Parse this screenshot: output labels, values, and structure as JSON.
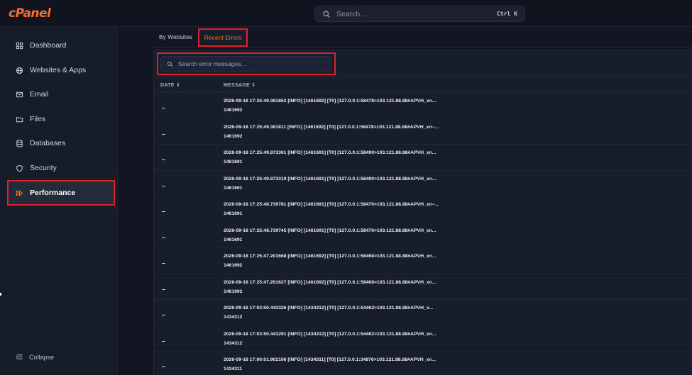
{
  "app": {
    "logo": "cPanel"
  },
  "search": {
    "placeholder": "Search...",
    "shortcut": "Ctrl K"
  },
  "sidebar": {
    "items": [
      {
        "label": "Dashboard",
        "icon": "grid-icon"
      },
      {
        "label": "Websites & Apps",
        "icon": "globe-icon"
      },
      {
        "label": "Email",
        "icon": "mail-icon"
      },
      {
        "label": "Files",
        "icon": "folder-icon"
      },
      {
        "label": "Databases",
        "icon": "database-icon"
      },
      {
        "label": "Security",
        "icon": "shield-icon"
      },
      {
        "label": "Performance",
        "icon": "fast-forward-icon",
        "active": true
      }
    ],
    "collapse_label": "Collapse"
  },
  "tabs": {
    "by_websites": "By Websites",
    "recent_errors": "Recent Errors"
  },
  "error_search": {
    "placeholder": "Search error messages..."
  },
  "table": {
    "columns": {
      "date": "DATE ⇕",
      "message": "MESSAGE ⇕"
    },
    "rows": [
      {
        "date": "–",
        "line1": "2026-09-18 17:25:49.361852 [INFO] [1461692] [T0] [127.0.0.1:58478>103.121.88.88#APVH_xn...",
        "line2": "1461692"
      },
      {
        "date": "–",
        "line1": "2026-09-18 17:25:49.361811 [INFO] [1461692] [T0] [127.0.0.1:58478>103.121.88.88#APVH_xn--...",
        "line2": "1461692"
      },
      {
        "date": "–",
        "line1": "2026-09-18 17:25:49.873361 [INFO] [1461691] [T0] [127.0.0.1:58490>103.121.88.88#APVH_xn...",
        "line2": "1461691"
      },
      {
        "date": "–",
        "line1": "2026-09-18 17:25:49.873319 [INFO] [1461691] [T0] [127.0.0.1:58490>103.121.88.88#APVH_xn...",
        "line2": "1461691"
      },
      {
        "date": "–",
        "line1": "2026-09-18 17:25:48.739781 [INFO] [1461691] [T0] [127.0.0.1:58470>103.121.88.88#APVH_xn--...",
        "line2": "1461691"
      },
      {
        "date": "–",
        "line1": "2026-09-18 17:25:48.739745 [INFO] [1461691] [T0] [127.0.0.1:58470>103.121.88.88#APVH_xn...",
        "line2": "1461691"
      },
      {
        "date": "–",
        "line1": "2026-09-18 17:25:47.201668 [INFO] [1461692] [T0] [127.0.0.1:58468>103.121.88.88#APVH_xn...",
        "line2": "1461692"
      },
      {
        "date": "–",
        "line1": "2026-09-18 17:25:47.201627 [INFO] [1461692] [T0] [127.0.0.1:58468>103.121.88.88#APVH_xn...",
        "line2": "1461692"
      },
      {
        "date": "–",
        "line1": "2026-09-18 17:03:50.443326 [INFO] [1434312] [T0] [127.0.0.1:54462>103.121.88.88#APVH_x...",
        "line2": "1434312"
      },
      {
        "date": "–",
        "line1": "2026-09-18 17:03:50.443291 [INFO] [1434312] [T0] [127.0.0.1:54462>103.121.88.88#APVH_xn...",
        "line2": "1434312"
      },
      {
        "date": "–",
        "line1": "2026-09-18 17:00:01.902106 [INFO] [1434311] [T0] [127.0.0.1:34876>103.121.88.88#APVH_xn...",
        "line2": "1434311"
      }
    ]
  },
  "colors": {
    "accent": "#ff6c2c",
    "highlight": "#e0202a",
    "background": "#111622"
  }
}
